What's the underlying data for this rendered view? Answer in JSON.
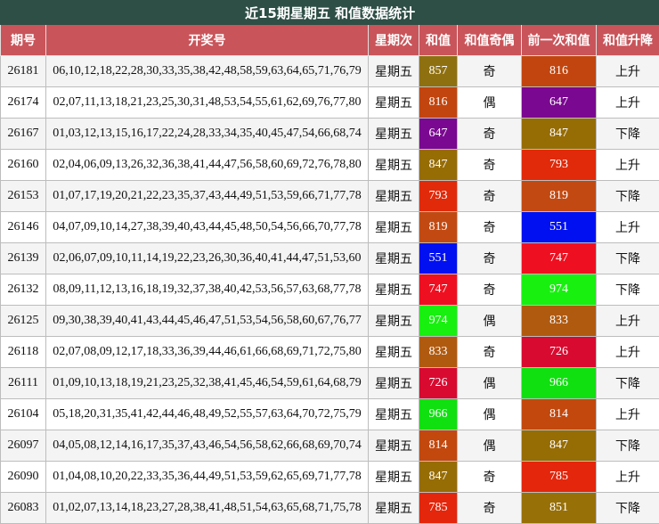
{
  "title": "近15期星期五 和值数据统计",
  "headers": [
    "期号",
    "开奖号",
    "星期次",
    "和值",
    "和值奇偶",
    "前一次和值",
    "和值升降"
  ],
  "rows": [
    {
      "issue": "26181",
      "numbers": "06,10,12,18,22,28,30,33,35,38,42,48,58,59,63,64,65,71,76,79",
      "weekday": "星期五",
      "sum": "857",
      "sum_color": "#8f7010",
      "parity": "奇",
      "prev": "816",
      "prev_color": "#c2450f",
      "trend": "上升"
    },
    {
      "issue": "26174",
      "numbers": "02,07,11,13,18,21,23,25,30,31,48,53,54,55,61,62,69,76,77,80",
      "weekday": "星期五",
      "sum": "816",
      "sum_color": "#c2450f",
      "parity": "偶",
      "prev": "647",
      "prev_color": "#7a0890",
      "trend": "上升"
    },
    {
      "issue": "26167",
      "numbers": "01,03,12,13,15,16,17,22,24,28,33,34,35,40,45,47,54,66,68,74",
      "weekday": "星期五",
      "sum": "647",
      "sum_color": "#7a0890",
      "parity": "奇",
      "prev": "847",
      "prev_color": "#966c05",
      "trend": "下降"
    },
    {
      "issue": "26160",
      "numbers": "02,04,06,09,13,26,32,36,38,41,44,47,56,58,60,69,72,76,78,80",
      "weekday": "星期五",
      "sum": "847",
      "sum_color": "#966c05",
      "parity": "奇",
      "prev": "793",
      "prev_color": "#e02a0a",
      "trend": "上升"
    },
    {
      "issue": "26153",
      "numbers": "01,07,17,19,20,21,22,23,35,37,43,44,49,51,53,59,66,71,77,78",
      "weekday": "星期五",
      "sum": "793",
      "sum_color": "#e02a0a",
      "parity": "奇",
      "prev": "819",
      "prev_color": "#c24a12",
      "trend": "下降"
    },
    {
      "issue": "26146",
      "numbers": "04,07,09,10,14,27,38,39,40,43,44,45,48,50,54,56,66,70,77,78",
      "weekday": "星期五",
      "sum": "819",
      "sum_color": "#c24a12",
      "parity": "奇",
      "prev": "551",
      "prev_color": "#0010f0",
      "trend": "上升"
    },
    {
      "issue": "26139",
      "numbers": "02,06,07,09,10,11,14,19,22,23,26,30,36,40,41,44,47,51,53,60",
      "weekday": "星期五",
      "sum": "551",
      "sum_color": "#0010f0",
      "parity": "奇",
      "prev": "747",
      "prev_color": "#ee1020",
      "trend": "下降"
    },
    {
      "issue": "26132",
      "numbers": "08,09,11,12,13,16,18,19,32,37,38,40,42,53,56,57,63,68,77,78",
      "weekday": "星期五",
      "sum": "747",
      "sum_color": "#ee1020",
      "parity": "奇",
      "prev": "974",
      "prev_color": "#18f010",
      "trend": "下降"
    },
    {
      "issue": "26125",
      "numbers": "09,30,38,39,40,41,43,44,45,46,47,51,53,54,56,58,60,67,76,77",
      "weekday": "星期五",
      "sum": "974",
      "sum_color": "#18f010",
      "parity": "偶",
      "prev": "833",
      "prev_color": "#b05a10",
      "trend": "上升"
    },
    {
      "issue": "26118",
      "numbers": "02,07,08,09,12,17,18,33,36,39,44,46,61,66,68,69,71,72,75,80",
      "weekday": "星期五",
      "sum": "833",
      "sum_color": "#b05a10",
      "parity": "奇",
      "prev": "726",
      "prev_color": "#d80a30",
      "trend": "上升"
    },
    {
      "issue": "26111",
      "numbers": "01,09,10,13,18,19,21,23,25,32,38,41,45,46,54,59,61,64,68,79",
      "weekday": "星期五",
      "sum": "726",
      "sum_color": "#d80a30",
      "parity": "偶",
      "prev": "966",
      "prev_color": "#10e010",
      "trend": "下降"
    },
    {
      "issue": "26104",
      "numbers": "05,18,20,31,35,41,42,44,46,48,49,52,55,57,63,64,70,72,75,79",
      "weekday": "星期五",
      "sum": "966",
      "sum_color": "#10e010",
      "parity": "偶",
      "prev": "814",
      "prev_color": "#c2480e",
      "trend": "上升"
    },
    {
      "issue": "26097",
      "numbers": "04,05,08,12,14,16,17,35,37,43,46,54,56,58,62,66,68,69,70,74",
      "weekday": "星期五",
      "sum": "814",
      "sum_color": "#c2480e",
      "parity": "偶",
      "prev": "847",
      "prev_color": "#966c05",
      "trend": "下降"
    },
    {
      "issue": "26090",
      "numbers": "01,04,08,10,20,22,33,35,36,44,49,51,53,59,62,65,69,71,77,78",
      "weekday": "星期五",
      "sum": "847",
      "sum_color": "#966c05",
      "parity": "奇",
      "prev": "785",
      "prev_color": "#e3260c",
      "trend": "上升"
    },
    {
      "issue": "26083",
      "numbers": "01,02,07,13,14,18,23,27,28,38,41,48,51,54,63,65,68,71,75,78",
      "weekday": "星期五",
      "sum": "785",
      "sum_color": "#e3260c",
      "parity": "奇",
      "prev": "851",
      "prev_color": "#977008",
      "trend": "下降"
    }
  ]
}
